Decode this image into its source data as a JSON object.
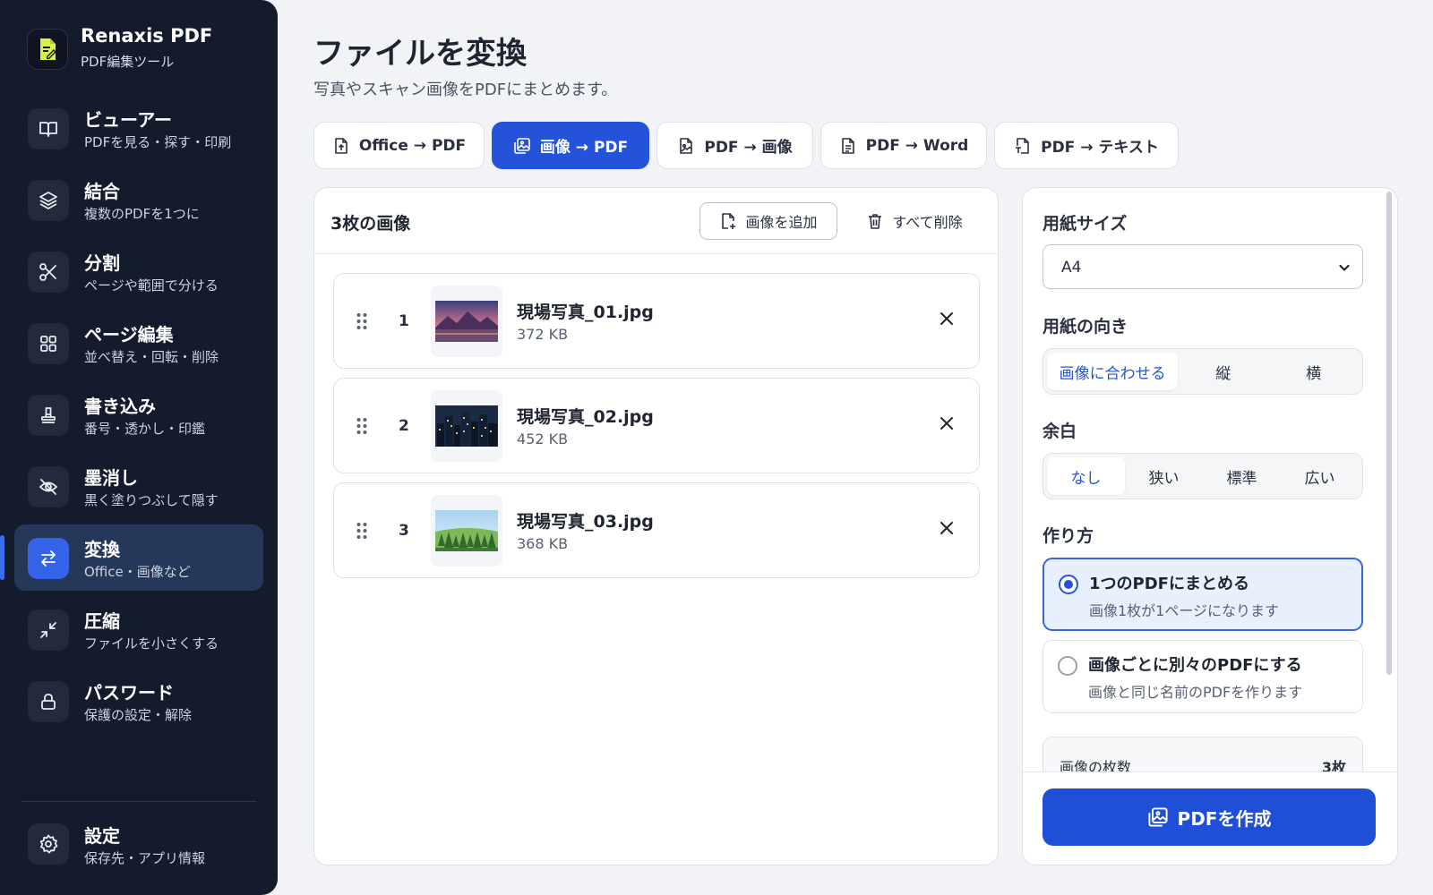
{
  "colors": {
    "sidebar_bg": "#141b2d",
    "accent": "#2453d9",
    "active_nav_bg": "#26385a",
    "logo_yellow": "#d9f24a"
  },
  "brand": {
    "name": "Renaxis PDF",
    "subtitle": "PDF編集ツール",
    "icon": "document-edit-icon"
  },
  "sidebar": {
    "items": [
      {
        "title": "ビューアー",
        "sub": "PDFを見る・探す・印刷",
        "icon": "book-icon"
      },
      {
        "title": "結合",
        "sub": "複数のPDFを1つに",
        "icon": "layers-icon"
      },
      {
        "title": "分割",
        "sub": "ページや範囲で分ける",
        "icon": "scissors-icon"
      },
      {
        "title": "ページ編集",
        "sub": "並べ替え・回転・削除",
        "icon": "grid-icon"
      },
      {
        "title": "書き込み",
        "sub": "番号・透かし・印鑑",
        "icon": "stamp-icon"
      },
      {
        "title": "墨消し",
        "sub": "黒く塗りつぶして隠す",
        "icon": "eye-off-icon"
      },
      {
        "title": "変換",
        "sub": "Office・画像など",
        "icon": "arrows-swap-icon",
        "active": true
      },
      {
        "title": "圧縮",
        "sub": "ファイルを小さくする",
        "icon": "minimize-icon"
      },
      {
        "title": "パスワード",
        "sub": "保護の設定・解除",
        "icon": "lock-icon"
      }
    ],
    "settings": {
      "title": "設定",
      "sub": "保存先・アプリ情報",
      "icon": "gear-icon"
    }
  },
  "header": {
    "title": "ファイルを変換",
    "subtitle": "写真やスキャン画像をPDFにまとめます。"
  },
  "tabs": [
    {
      "label": "Office → PDF",
      "icon": "file-upload-icon"
    },
    {
      "label": "画像 → PDF",
      "icon": "image-icon",
      "active": true
    },
    {
      "label": "PDF → 画像",
      "icon": "file-image-icon"
    },
    {
      "label": "PDF → Word",
      "icon": "file-text-icon"
    },
    {
      "label": "PDF → テキスト",
      "icon": "file-type-icon"
    }
  ],
  "images_panel": {
    "count_label": "3枚の画像",
    "add_label": "画像を追加",
    "clear_label": "すべて削除",
    "files": [
      {
        "num": "1",
        "name": "現場写真_01.jpg",
        "size": "372 KB",
        "thumb": "sunset-mountains"
      },
      {
        "num": "2",
        "name": "現場写真_02.jpg",
        "size": "452 KB",
        "thumb": "night-city"
      },
      {
        "num": "3",
        "name": "現場写真_03.jpg",
        "size": "368 KB",
        "thumb": "green-forest"
      }
    ]
  },
  "options": {
    "paper_size_label": "用紙サイズ",
    "paper_size_value": "A4",
    "orientation_label": "用紙の向き",
    "orientation_options": [
      "画像に合わせる",
      "縦",
      "横"
    ],
    "orientation_selected": "画像に合わせる",
    "margin_label": "余白",
    "margin_options": [
      "なし",
      "狭い",
      "標準",
      "広い"
    ],
    "margin_selected": "なし",
    "mode_label": "作り方",
    "modes": [
      {
        "title": "1つのPDFにまとめる",
        "desc": "画像1枚が1ページになります",
        "selected": true
      },
      {
        "title": "画像ごとに別々のPDFにする",
        "desc": "画像と同じ名前のPDFを作ります",
        "selected": false
      }
    ],
    "summary_label": "画像の枚数",
    "summary_value": "3枚",
    "create_label": "PDFを作成"
  }
}
